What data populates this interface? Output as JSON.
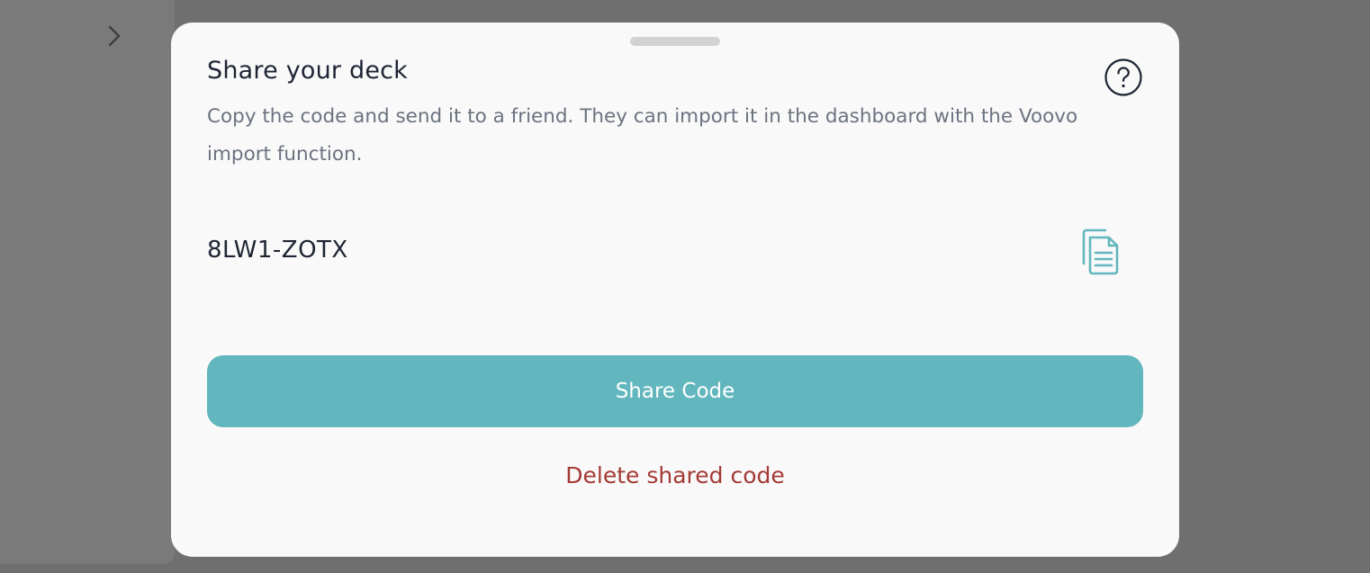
{
  "modal": {
    "title": "Share your deck",
    "subtitle": "Copy the code and send it to a friend. They can import it in the dashboard with the Voovo import function.",
    "share_code": "8LW1-ZOTX",
    "share_button_label": "Share Code",
    "delete_button_label": "Delete shared code"
  },
  "icons": {
    "help": "question-circle-icon",
    "copy": "clipboard-copy-icon",
    "background_nav": "chevron-right-icon"
  },
  "colors": {
    "accent": "#62b6bd",
    "danger": "#a33a35",
    "title_text": "#1d2433",
    "muted_text": "#6b7280",
    "modal_bg": "#f9f9f9",
    "overlay": "#6f6f70"
  }
}
